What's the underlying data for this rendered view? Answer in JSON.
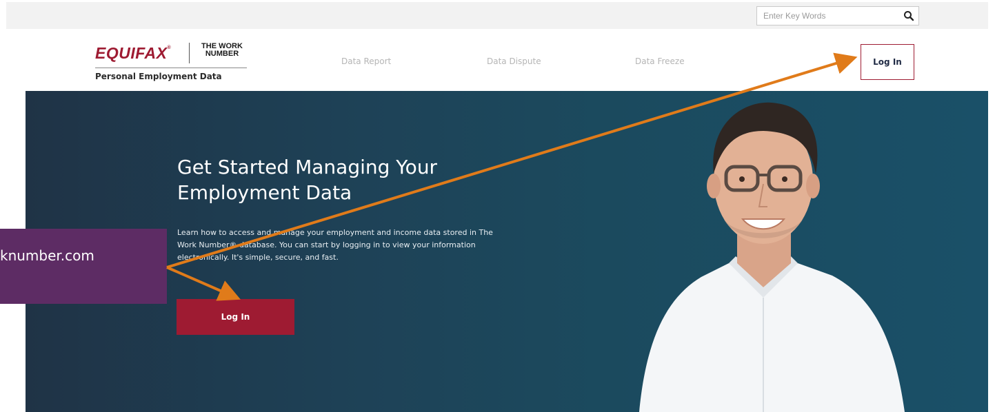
{
  "search": {
    "placeholder": "Enter Key Words",
    "icon": "search-icon"
  },
  "logo": {
    "brand": "EQUIFAX",
    "product_line1": "THE WORK",
    "product_line2": "NUMBER",
    "subtitle": "Personal Employment Data"
  },
  "nav": {
    "items": [
      {
        "label": "Data Report"
      },
      {
        "label": "Data Dispute"
      },
      {
        "label": "Data Freeze"
      }
    ],
    "login_label": "Log In"
  },
  "hero": {
    "title": "Get Started Managing Your Employment Data",
    "description": "Learn how to access and manage your employment and income data stored in The Work Number® database. You can start by logging in to view your information electronically. It's simple, secure, and fast.",
    "login_label": "Log In"
  },
  "callout": {
    "text": "knumber.com"
  },
  "colors": {
    "brand_red": "#9e1b32",
    "hero_bg": "#1e4257",
    "callout_purple": "#5d2c64",
    "arrow_orange": "#e07b1a"
  }
}
